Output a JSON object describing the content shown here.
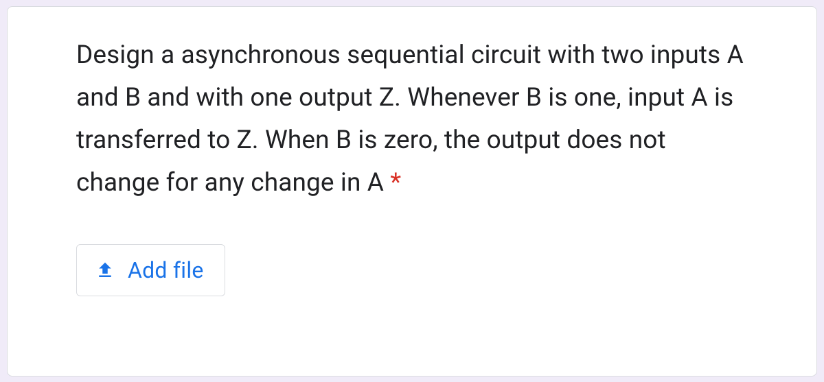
{
  "question": {
    "text": "Design a asynchronous sequential circuit with two inputs A and B and with one output Z. Whenever B is one, input A is transferred to Z. When B is zero, the output does not change for any change in A",
    "required": true,
    "required_indicator": " *"
  },
  "upload": {
    "button_label": "Add file",
    "icon_name": "upload-icon"
  }
}
